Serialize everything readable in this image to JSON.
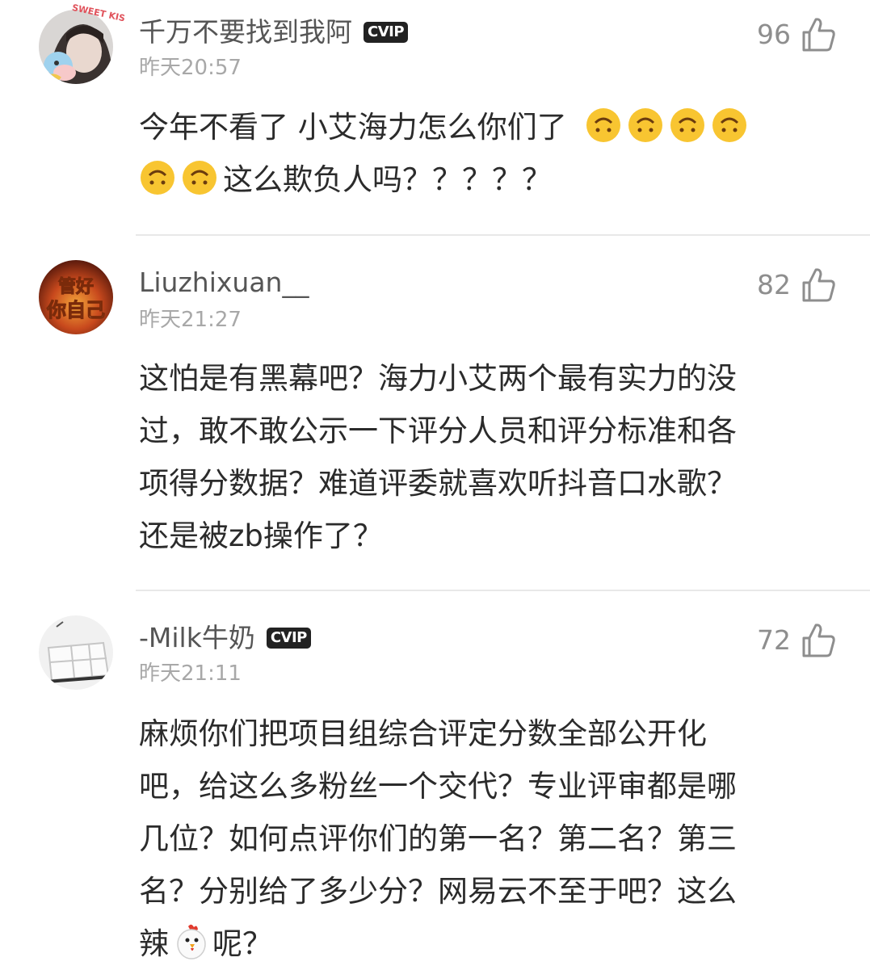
{
  "comments": [
    {
      "username": "千万不要找到我阿",
      "vip_badge": "CVIP",
      "time": "昨天20:57",
      "likes": "96",
      "text_lines": [
        "今年不看了 小艾海力怎么你们了",
        "这么欺负人吗？？？？？"
      ],
      "avatar_text": "SWEET KISS",
      "emoji": "upside-down-face-icon"
    },
    {
      "username": "Liuzhixuan__",
      "time": "昨天21:27",
      "likes": "82",
      "text_lines": [
        "这怕是有黑幕吧？海力小艾两个最有实力的没",
        "过，敢不敢公示一下评分人员和评分标准和各",
        "项得分数据？难道评委就喜欢听抖音口水歌？",
        "还是被zb操作了？"
      ],
      "avatar_text": "管好你自己"
    },
    {
      "username": "-Milk牛奶",
      "vip_badge": "CVIP",
      "time": "昨天21:11",
      "likes": "72",
      "text_lines": [
        "麻烦你们把项目组综合评定分数全部公开化",
        "吧，给这么多粉丝一个交代？专业评审都是哪",
        "几位？如何点评你们的第一名？第二名？第三",
        "名？分别给了多少分？网易云不至于吧？这么",
        "辣",
        "呢？"
      ],
      "emoji": "chicken-icon"
    }
  ],
  "colors": {
    "text": "#2b2b2b",
    "username": "#555555",
    "meta": "#a8a8a8",
    "divider": "#e8e8e8"
  }
}
